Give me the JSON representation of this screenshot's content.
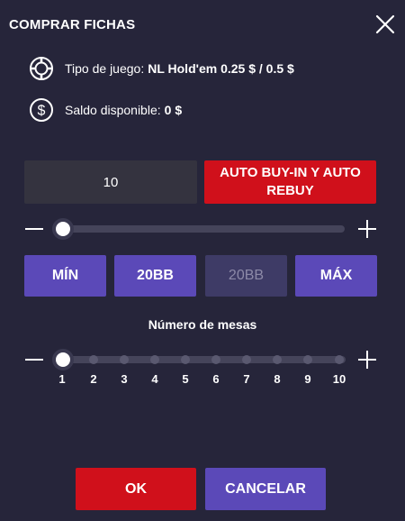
{
  "dialog": {
    "title": "COMPRAR FICHAS"
  },
  "info": {
    "game_type_label": "Tipo de juego:",
    "game_type_value": "NL Hold'em 0.25 $ / 0.5 $",
    "balance_label": "Saldo disponible:",
    "balance_value": "0 $"
  },
  "buyin": {
    "amount": "10",
    "auto_button_label": "AUTO BUY-IN Y AUTO REBUY",
    "slider_position": 0
  },
  "presets": [
    {
      "label": "MÍN",
      "enabled": true
    },
    {
      "label": "20BB",
      "enabled": true
    },
    {
      "label": "20BB",
      "enabled": false
    },
    {
      "label": "MÁX",
      "enabled": true
    }
  ],
  "tables": {
    "label": "Número de mesas",
    "selected": "1",
    "ticks": [
      "1",
      "2",
      "3",
      "4",
      "5",
      "6",
      "7",
      "8",
      "9",
      "10"
    ]
  },
  "actions": {
    "ok_label": "OK",
    "cancel_label": "CANCELAR"
  },
  "colors": {
    "background": "#26253a",
    "accent_red": "#d0101b",
    "accent_purple": "#5b49b8"
  },
  "icons": {
    "close": "close-icon",
    "game_type": "poker-chip-icon",
    "balance": "dollar-coin-icon",
    "minus": "minus-icon",
    "plus": "plus-icon"
  }
}
